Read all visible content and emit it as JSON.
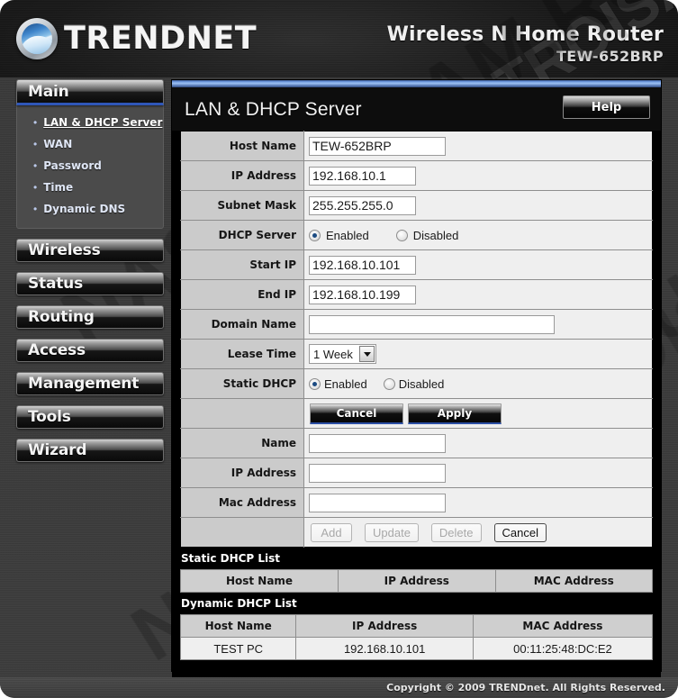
{
  "brand": {
    "name": "TRENDNET",
    "logo_icon": "trendnet-globe-icon",
    "product_line": "Wireless N Home Router",
    "model": "TEW-652BRP"
  },
  "watermark": {
    "text1": "NASTROISAM.RU",
    "text2": "NASTROISAM.RU",
    "text3": "NASTROISAM.RU",
    "text4": "NASTROISAM.RU"
  },
  "sidebar": {
    "items": [
      {
        "label": "Main",
        "active": true
      },
      {
        "label": "Wireless",
        "active": false
      },
      {
        "label": "Status",
        "active": false
      },
      {
        "label": "Routing",
        "active": false
      },
      {
        "label": "Access",
        "active": false
      },
      {
        "label": "Management",
        "active": false
      },
      {
        "label": "Tools",
        "active": false
      },
      {
        "label": "Wizard",
        "active": false
      }
    ],
    "submenu": [
      {
        "label": "LAN & DHCP Server",
        "current": true
      },
      {
        "label": "WAN",
        "current": false
      },
      {
        "label": "Password",
        "current": false
      },
      {
        "label": "Time",
        "current": false
      },
      {
        "label": "Dynamic DNS",
        "current": false
      }
    ],
    "bullet": "•"
  },
  "panel": {
    "title": "LAN & DHCP Server",
    "help_label": "Help"
  },
  "form": {
    "host_name": {
      "label": "Host Name",
      "value": "TEW-652BRP"
    },
    "ip_address": {
      "label": "IP Address",
      "value": "192.168.10.1"
    },
    "subnet_mask": {
      "label": "Subnet Mask",
      "value": "255.255.255.0"
    },
    "dhcp_server": {
      "label": "DHCP Server",
      "enabled_label": "Enabled",
      "disabled_label": "Disabled",
      "selected": "Enabled"
    },
    "start_ip": {
      "label": "Start IP",
      "value": "192.168.10.101"
    },
    "end_ip": {
      "label": "End IP",
      "value": "192.168.10.199"
    },
    "domain_name": {
      "label": "Domain Name",
      "value": ""
    },
    "lease_time": {
      "label": "Lease Time",
      "value": "1 Week",
      "options": [
        "1 Week"
      ],
      "arrow_icon": "chevron-down-icon"
    },
    "static_dhcp": {
      "label": "Static DHCP",
      "enabled_label": "Enabled",
      "disabled_label": "Disabled",
      "selected": "Enabled"
    },
    "actions": {
      "cancel": "Cancel",
      "apply": "Apply"
    },
    "entry_name": {
      "label": "Name",
      "value": ""
    },
    "entry_ip": {
      "label": "IP Address",
      "value": ""
    },
    "entry_mac": {
      "label": "Mac Address",
      "value": ""
    },
    "entry_actions": {
      "add": "Add",
      "update": "Update",
      "delete": "Delete",
      "cancel": "Cancel"
    }
  },
  "static_list": {
    "title": "Static DHCP List",
    "columns": [
      "Host Name",
      "IP Address",
      "MAC Address"
    ],
    "rows": []
  },
  "dynamic_list": {
    "title": "Dynamic DHCP List",
    "columns": [
      "Host Name",
      "IP Address",
      "MAC Address"
    ],
    "rows": [
      {
        "host": "TEST PC",
        "ip": "192.168.10.101",
        "mac": "00:11:25:48:DC:E2"
      }
    ]
  },
  "footer": {
    "copyright": "Copyright © 2009 TRENDnet. All Rights Reserved."
  },
  "colors": {
    "accent_blue": "#2f56b8",
    "panel_black": "#000000",
    "label_grey": "#cbcbcb",
    "field_grey": "#efefef"
  }
}
